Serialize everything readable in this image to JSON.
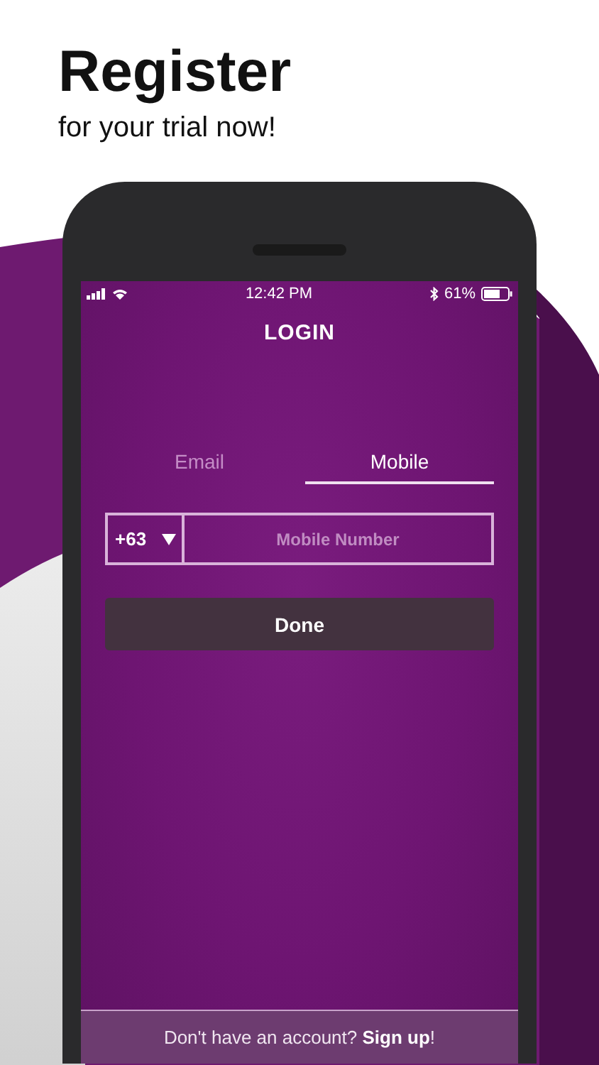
{
  "promo": {
    "title": "Register",
    "subtitle": "for your trial now!"
  },
  "status_bar": {
    "time": "12:42 PM",
    "battery": "61%"
  },
  "screen": {
    "title": "LOGIN"
  },
  "tabs": [
    {
      "label": "Email",
      "selected": false
    },
    {
      "label": "Mobile",
      "selected": true
    }
  ],
  "phone_field": {
    "country_code": "+63",
    "placeholder": "Mobile Number"
  },
  "done_button": "Done",
  "footer": {
    "text": "Don't have an account?",
    "link": "Sign up",
    "suffix": "!"
  }
}
